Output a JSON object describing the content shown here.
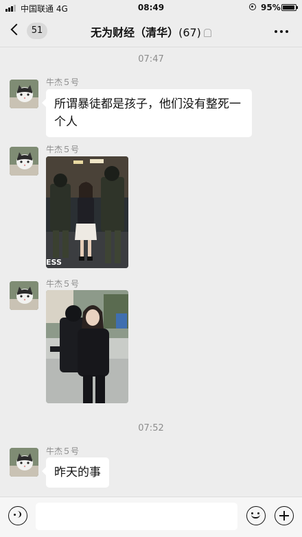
{
  "status_bar": {
    "carrier": "中国联通 4G",
    "time": "08:49",
    "battery": "95%"
  },
  "header": {
    "back_count": "51",
    "group_name": "无为财经（清华）",
    "member_count": "(67)"
  },
  "chat": {
    "timestamps": [
      "07:47",
      "07:52"
    ],
    "messages": [
      {
        "sender": "牛杰５号",
        "type": "text",
        "text": "所谓暴徒都是孩子，他们没有整死一个人"
      },
      {
        "sender": "牛杰５号",
        "type": "image",
        "watermark": "ESS"
      },
      {
        "sender": "牛杰５号",
        "type": "image"
      },
      {
        "sender": "牛杰５号",
        "type": "text",
        "text": "昨天的事"
      }
    ]
  },
  "input_bar": {
    "placeholder": ""
  },
  "icons": [
    "voice-icon",
    "emoji-icon",
    "plus-icon",
    "back-icon",
    "more-icon"
  ]
}
